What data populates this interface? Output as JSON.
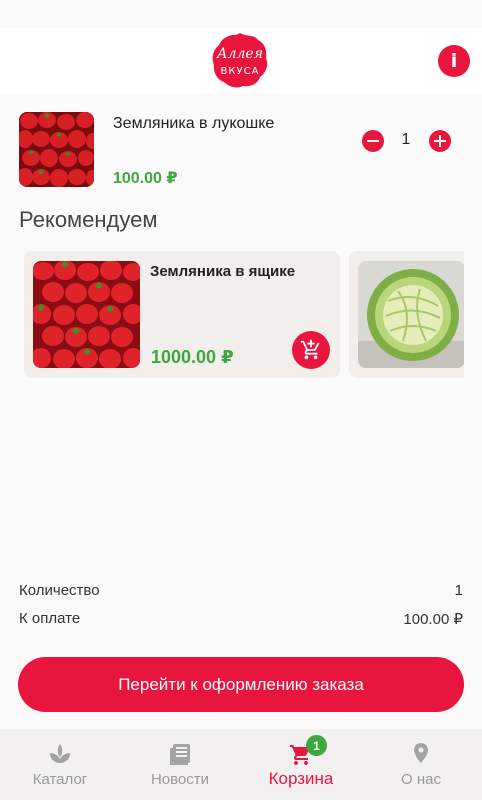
{
  "header": {
    "logo_line1": "Аллея",
    "logo_line2": "ВКУСА",
    "info_glyph": "i"
  },
  "cart": {
    "items": [
      {
        "name": "Земляника в лукошке",
        "price": "100.00 ₽",
        "quantity": "1"
      }
    ]
  },
  "recommended": {
    "title": "Рекомендуем",
    "items": [
      {
        "name": "Земляника в ящике",
        "price": "1000.00 ₽"
      },
      {
        "name": "",
        "price": ""
      }
    ]
  },
  "summary": {
    "quantity_label": "Количество",
    "quantity_value": "1",
    "total_label": "К оплате",
    "total_value": "100.00 ₽"
  },
  "checkout_button": "Перейти к оформлению заказа",
  "nav": {
    "items": [
      {
        "label": "Каталог",
        "icon": "leaf-icon"
      },
      {
        "label": "Новости",
        "icon": "news-icon"
      },
      {
        "label": "Корзина",
        "icon": "cart-icon",
        "badge": "1"
      },
      {
        "label": "О нас",
        "icon": "location-pin-icon"
      }
    ],
    "active": "Корзина"
  },
  "colors": {
    "accent": "#e8163f",
    "price_green": "#3ca63f",
    "nav_inactive": "#9a9a9a"
  }
}
